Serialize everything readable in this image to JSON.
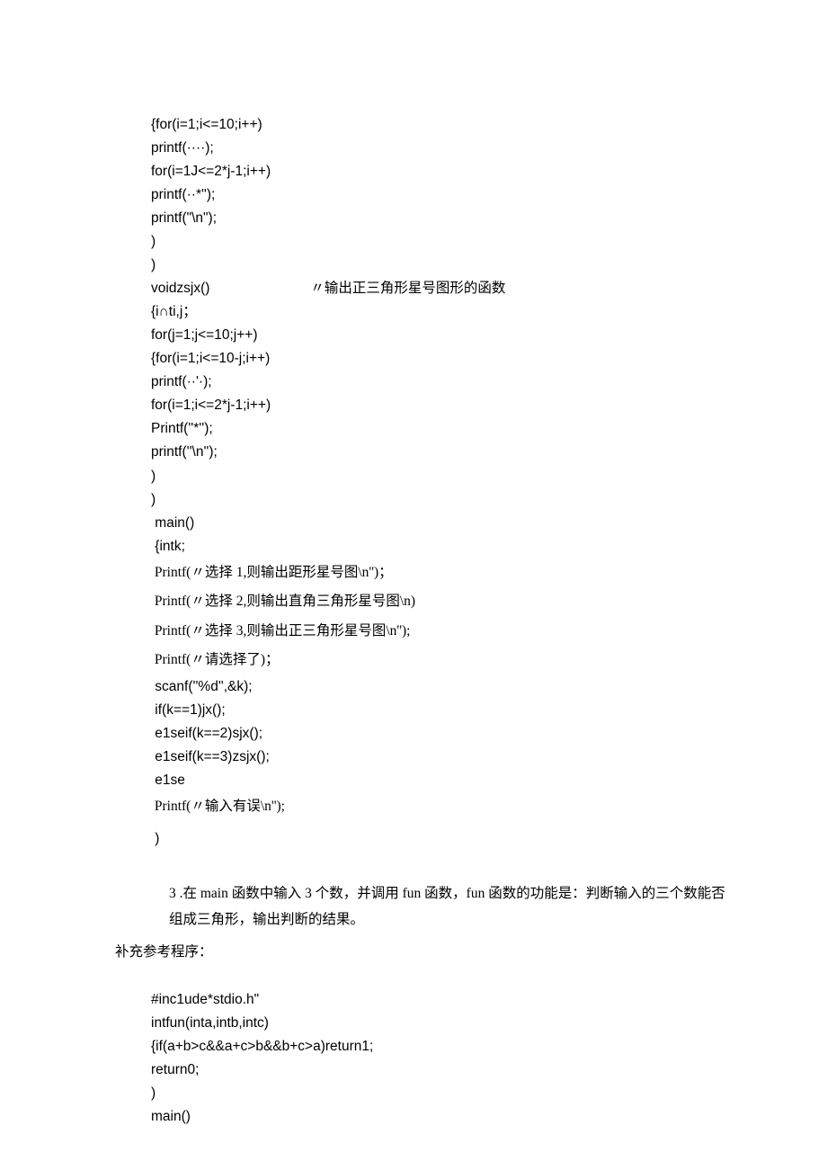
{
  "block1": {
    "l1": "{for(i=1;i<=10;i++)",
    "l2": "printf(····);",
    "l3": "for(i=1J<=2*j-1;i++)",
    "l4": "printf(··*'');",
    "l5": "printf(\"\\n\");",
    "l6": ")",
    "l7": ")",
    "l8a": "voidzsjx()",
    "l8b": "〃输出正三角形星号图形的函数",
    "l9": "{i∩ti,j；",
    "l10": "for(j=1;j<=10;j++)",
    "l11": "{for(i=1;i<=10-j;i++)",
    "l12": "printf(··'·);",
    "l13": "for(i=1;i<=2*j-1;i++)",
    "l14": "Printf(''*'');",
    "l15": "printf(''\\n'');",
    "l16": ")",
    "l17": ")",
    "l18": " main()",
    "l19": " {intk;",
    "l20": " Printf(〃选择 1,则输出距形星号图\\n'')；",
    "l21": " Printf(〃选择 2,则输出直角三角形星号图\\n)",
    "l22": " Printf(〃选择 3,则输出正三角形星号图\\n'');",
    "l23": " Printf(〃请选择了)；",
    "l24": " scanf(''%d'',&k);",
    "l25": " if(k==1)jx();",
    "l26": " e1seif(k==2)sjx();",
    "l27": " e1seif(k==3)zsjx();",
    "l28": " e1se",
    "l29": " Printf(〃输入有误\\n'');",
    "l30": " )"
  },
  "question": {
    "num": "3 .",
    "text": "在 main 函数中输入 3 个数，并调用 fun 函数，fun 函数的功能是：判断输入的三个数能否组成三角形，输出判断的结果。"
  },
  "supp": "补充参考程序：",
  "block2": {
    "l1": "#inc1ude*stdio.h\"",
    "l2": "intfun(inta,intb,intc)",
    "l3": "{if(a+b>c&&a+c>b&&b+c>a)return1;",
    "l4": "return0;",
    "l5": ")",
    "l6": "main()"
  }
}
